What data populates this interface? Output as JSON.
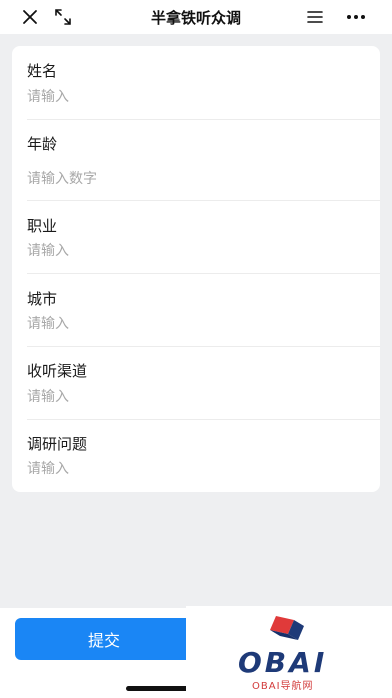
{
  "header": {
    "title": "半拿铁听众调",
    "close_icon": "close-icon",
    "expand_icon": "expand-icon",
    "menu_icon": "menu-icon",
    "more_icon": "more-icon"
  },
  "form": {
    "fields": [
      {
        "label": "姓名",
        "placeholder": "请输入"
      },
      {
        "label": "年龄",
        "placeholder": "请输入数字"
      },
      {
        "label": "职业",
        "placeholder": "请输入"
      },
      {
        "label": "城市",
        "placeholder": "请输入"
      },
      {
        "label": "收听渠道",
        "placeholder": "请输入"
      },
      {
        "label": "调研问题",
        "placeholder": "请输入"
      }
    ]
  },
  "footer": {
    "submit_label": "提交"
  },
  "watermark": {
    "logo_text": "OBAI",
    "logo_sub": "OBAI导航网",
    "accent_red": "#d23a3a",
    "accent_blue": "#1e3a78"
  },
  "colors": {
    "primary": "#1a86f5",
    "background": "#eeeff1"
  }
}
